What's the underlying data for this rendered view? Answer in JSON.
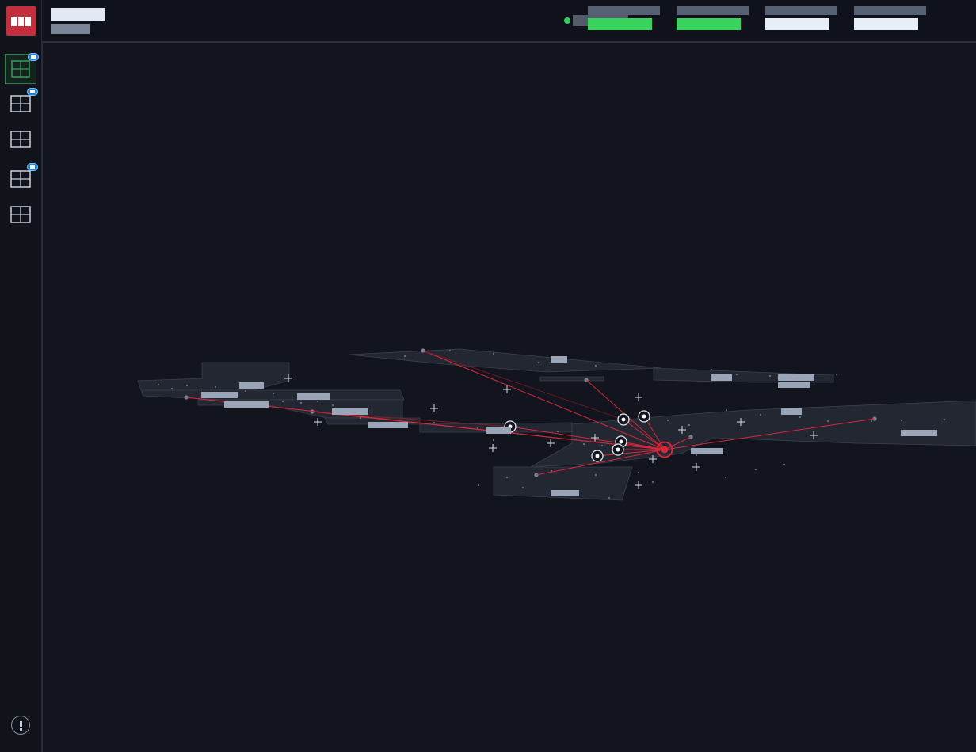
{
  "header": {
    "title": "",
    "subtitle": "",
    "status": {
      "color": "#2fd15c",
      "text": ""
    },
    "metrics": [
      {
        "label": "",
        "value": "",
        "color": "#37d35c"
      },
      {
        "label": "",
        "value": "",
        "color": "#37d35c"
      },
      {
        "label": "",
        "value": "",
        "color": "#e6eef8"
      },
      {
        "label": "",
        "value": "",
        "color": "#e6eef8"
      }
    ]
  },
  "sidebar": {
    "logo_icon": "app-logo-bars",
    "items": [
      {
        "icon": "grid-icon",
        "active": true,
        "badge": true
      },
      {
        "icon": "grid-icon",
        "active": false,
        "badge": true
      },
      {
        "icon": "grid-icon",
        "active": false,
        "badge": false
      },
      {
        "icon": "grid-icon",
        "active": false,
        "badge": true
      },
      {
        "icon": "grid-icon",
        "active": false,
        "badge": false
      }
    ],
    "footer_icon": "alert-icon"
  },
  "map": {
    "region_color": "#232731",
    "link_color": "#d6293b",
    "hub_color": "#d6293b",
    "label_color": "#9aa6b8",
    "node_labels": [
      "",
      "",
      "",
      "",
      "",
      "",
      "",
      "",
      "",
      "",
      "",
      "",
      "",
      "",
      "",
      "",
      "",
      ""
    ]
  }
}
